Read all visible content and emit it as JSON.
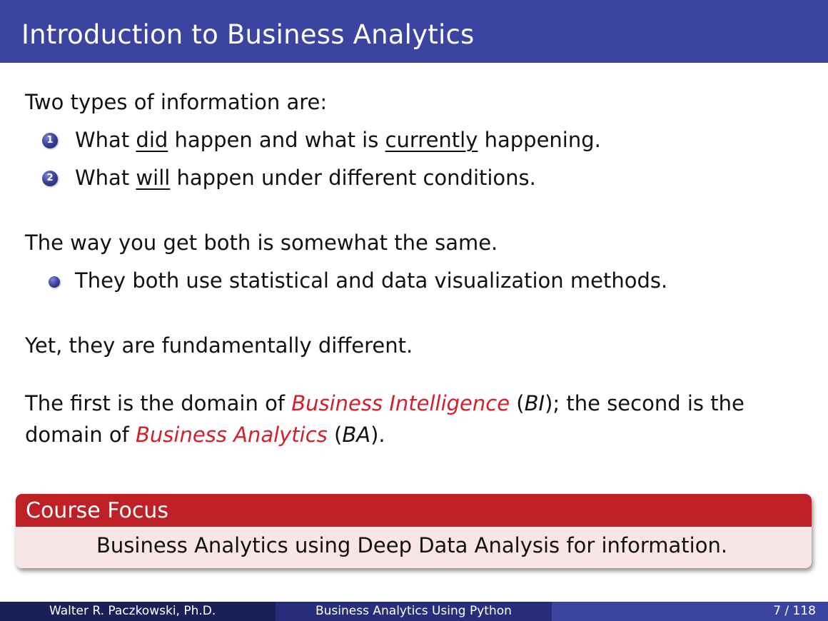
{
  "slide": {
    "title": "Introduction to Business Analytics",
    "intro": "Two types of information are:",
    "enum_items": [
      {
        "number": "1",
        "pre": "What ",
        "underlined": "did",
        "mid": " happen and what is ",
        "underlined2": "currently",
        "post": " happening."
      },
      {
        "number": "2",
        "pre": "What ",
        "underlined": "will",
        "post": " happen under different conditions."
      }
    ],
    "way_line": "The way you get both is somewhat the same.",
    "bullet_item": "They both use statistical and data visualization methods.",
    "yet_line": "Yet, they are fundamentally different.",
    "domain_para": {
      "part1": "The first is the domain of ",
      "bi_term": "Business Intelligence",
      "part2": " (",
      "bi_abbr": "BI",
      "part3": "); the second is the",
      "part4": "domain of ",
      "ba_term": "Business Analytics",
      "part5": " (",
      "ba_abbr": "BA",
      "part6": ")."
    },
    "block": {
      "title": "Course Focus",
      "body": "Business Analytics using Deep Data Analysis for information."
    }
  },
  "footer": {
    "author": "Walter R. Paczkowski, Ph.D.",
    "course": "Business Analytics Using Python",
    "page": "7 / 118"
  },
  "colors": {
    "title_bar": "#3b44a0",
    "emphasis_red": "#d4202a",
    "block_header": "#bf2026",
    "block_body": "#f8e5e6"
  }
}
